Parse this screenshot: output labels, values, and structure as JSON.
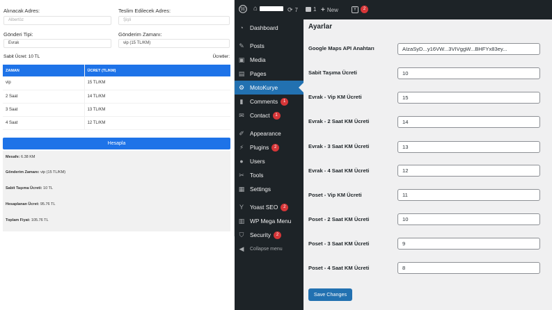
{
  "frontend": {
    "pickup_label": "Alınacak Adres:",
    "pickup_placeholder": "Albertöz",
    "delivery_label": "Teslim Edilecek Adres:",
    "delivery_placeholder": "Şişli",
    "send_type_label": "Gönderi Tipi:",
    "send_type_value": "Evrak",
    "send_time_label": "Gönderim Zamanı:",
    "send_time_value": "vip (15 TL/KM)",
    "fixed_fee": "Sabit Ücret: 10 TL",
    "prices_label": "Ücretler:",
    "table_headers": [
      "ZAMAN",
      "ÜCRET (TL/KM)"
    ],
    "table_rows": [
      [
        "vip",
        "15 TL/KM"
      ],
      [
        "2 Saat",
        "14 TL/KM"
      ],
      [
        "3 Saat",
        "13 TL/KM"
      ],
      [
        "4 Saat",
        "12 TL/KM"
      ]
    ],
    "calculate_button": "Hesapla",
    "results": [
      {
        "label": "Mesafe:",
        "value": " 6.38 KM"
      },
      {
        "label": "Gönderim Zamanı:",
        "value": " vip (15 TL/KM)"
      },
      {
        "label": "Sabit Taşıma Ücreti:",
        "value": " 10 TL"
      },
      {
        "label": "Hesaplanan Ücret:",
        "value": " 95.76 TL"
      },
      {
        "label": "Toplam Fiyat:",
        "value": " 105.76 TL"
      }
    ]
  },
  "adminbar": {
    "updates": "7",
    "comments": "1",
    "new_label": "New",
    "yoast_badge": "2"
  },
  "sidebar": {
    "items": [
      {
        "label": "Dashboard",
        "icon": "dashboard-icon"
      },
      {
        "label": "Posts",
        "icon": "pin-icon"
      },
      {
        "label": "Media",
        "icon": "media-icon"
      },
      {
        "label": "Pages",
        "icon": "page-icon"
      },
      {
        "label": "MotoKurye",
        "icon": "gear-icon"
      },
      {
        "label": "Comments",
        "icon": "comment-icon",
        "badge": "1"
      },
      {
        "label": "Contact",
        "icon": "mail-icon",
        "badge": "1"
      },
      {
        "label": "Appearance",
        "icon": "brush-icon"
      },
      {
        "label": "Plugins",
        "icon": "plug-icon",
        "badge": "2"
      },
      {
        "label": "Users",
        "icon": "user-icon"
      },
      {
        "label": "Tools",
        "icon": "wrench-icon"
      },
      {
        "label": "Settings",
        "icon": "settings-icon"
      },
      {
        "label": "Yoast SEO",
        "icon": "yoast-icon",
        "badge": "2"
      },
      {
        "label": "WP Mega Menu",
        "icon": "menu-icon"
      },
      {
        "label": "Security",
        "icon": "shield-icon",
        "badge": "2"
      },
      {
        "label": "Collapse menu",
        "icon": "collapse-icon"
      }
    ]
  },
  "settings": {
    "title": "Ayarlar",
    "fields": [
      {
        "label": "Google Maps API Anahtarı",
        "value": "AIzaSyD...y16VW...3VIVggW...BHFYx83ey..."
      },
      {
        "label": "Sabit Taşıma Ücreti",
        "value": "10"
      },
      {
        "label": "Evrak - Vip KM Ücreti",
        "value": "15"
      },
      {
        "label": "Evrak - 2 Saat KM Ücreti",
        "value": "14"
      },
      {
        "label": "Evrak - 3 Saat KM Ücreti",
        "value": "13"
      },
      {
        "label": "Evrak - 4 Saat KM Ücreti",
        "value": "12"
      },
      {
        "label": "Poset - Vip KM Ücreti",
        "value": "11"
      },
      {
        "label": "Poset - 2 Saat KM Ücreti",
        "value": "10"
      },
      {
        "label": "Poset - 3 Saat KM Ücreti",
        "value": "9"
      },
      {
        "label": "Poset - 4 Saat KM Ücreti",
        "value": "8"
      }
    ],
    "save_label": "Save Changes"
  },
  "colors": {
    "accent": "#2271b1",
    "sidebar_bg": "#1d2327",
    "frontend_blue": "#1e73e8",
    "badge": "#d63638"
  }
}
